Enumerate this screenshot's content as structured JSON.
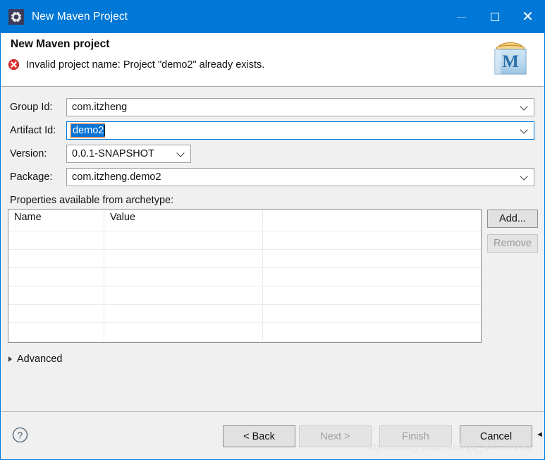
{
  "window": {
    "title": "New Maven Project",
    "title_icon": "gear-icon",
    "minimize_label": "–",
    "maximize_label": "□",
    "close_label": "✕"
  },
  "header": {
    "title": "New Maven project",
    "error_icon": "error-circle-icon",
    "error_message": "Invalid project name: Project \"demo2\" already exists.",
    "brand_icon": "maven-logo-icon",
    "brand_letter": "M"
  },
  "form": {
    "group_id": {
      "label": "Group Id:",
      "value": "com.itzheng",
      "dropdown_icon": "chevron-down-icon"
    },
    "artifact_id": {
      "label": "Artifact Id:",
      "value": "demo2",
      "selected": true,
      "focused": true,
      "dropdown_icon": "chevron-down-icon"
    },
    "version": {
      "label": "Version:",
      "value": "0.0.1-SNAPSHOT",
      "dropdown_icon": "chevron-down-icon"
    },
    "package": {
      "label": "Package:",
      "value": "com.itzheng.demo2",
      "dropdown_icon": "chevron-down-icon"
    }
  },
  "properties": {
    "label": "Properties available from archetype:",
    "columns": [
      "Name",
      "Value",
      ""
    ],
    "rows": [
      [
        "",
        "",
        ""
      ],
      [
        "",
        "",
        ""
      ],
      [
        "",
        "",
        ""
      ],
      [
        "",
        "",
        ""
      ],
      [
        "",
        "",
        ""
      ],
      [
        "",
        "",
        ""
      ]
    ],
    "add_button": "Add...",
    "remove_button": "Remove",
    "remove_disabled": true
  },
  "advanced": {
    "label": "Advanced",
    "expanded": false,
    "toggle_icon": "triangle-right-icon"
  },
  "footer": {
    "help_icon": "question-mark-icon",
    "back_button": "< Back",
    "next_button": "Next >",
    "next_disabled": true,
    "finish_button": "Finish",
    "finish_disabled": true,
    "cancel_button": "Cancel"
  },
  "watermark": {
    "text": "https://blog.csdn.net/qq_44757034"
  },
  "colors": {
    "titlebar": "#0078d7",
    "accent": "#0078d7",
    "error": "#d32f2f",
    "body": "#f0f0f0",
    "selection": "#0a73d6"
  }
}
